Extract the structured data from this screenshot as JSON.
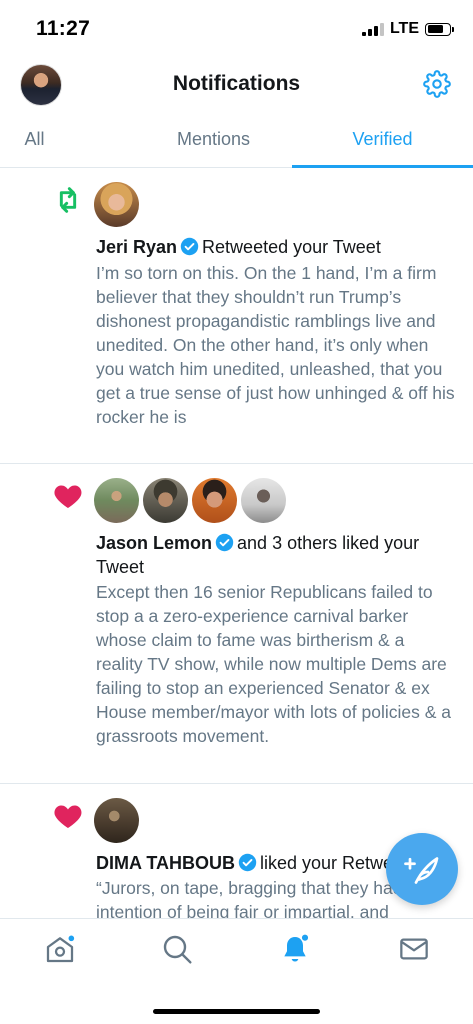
{
  "status_bar": {
    "time": "11:27",
    "network": "LTE",
    "battery_level": 0.75
  },
  "header": {
    "title": "Notifications",
    "avatar_icon": "profile-avatar",
    "settings_icon": "gear-icon"
  },
  "tabs": [
    {
      "label": "All",
      "active": false
    },
    {
      "label": "Mentions",
      "active": false
    },
    {
      "label": "Verified",
      "active": true
    }
  ],
  "notifications": [
    {
      "type": "retweet",
      "icon": "retweet-icon",
      "user": "Jeri Ryan",
      "verified": true,
      "action": "Retweeted your Tweet",
      "tweet": "I’m so torn on this. On the 1 hand, I’m a firm believer that they shouldn’t run Trump’s dishonest propagandistic ramblings live and unedited. On the other hand, it’s only when you watch him unedited, unleashed, that you get a true sense of just how unhinged & off his rocker he is"
    },
    {
      "type": "like",
      "icon": "heart-icon",
      "user": "Jason Lemon",
      "verified": true,
      "action": "and 3 others liked your Tweet",
      "tweet": "Except then 16 senior Republicans failed to stop a a zero-experience carnival barker whose claim to fame was birtherism & a reality TV show, while now multiple Dems are failing to stop an experienced Senator & ex House member/mayor with lots of policies & a grassroots movement."
    },
    {
      "type": "like",
      "icon": "heart-icon",
      "user": "DIMA TAHBOUB",
      "verified": true,
      "action": "liked your Retweet",
      "tweet": "“Jurors, on tape, bragging that they had no intention of being fair or impartial, and"
    }
  ],
  "compose": {
    "icon": "compose-tweet-icon"
  },
  "tab_bar": [
    {
      "icon": "home-icon",
      "has_dot": true
    },
    {
      "icon": "search-icon",
      "has_dot": false
    },
    {
      "icon": "bell-icon",
      "has_dot": true,
      "active": true
    },
    {
      "icon": "mail-icon",
      "has_dot": false
    }
  ],
  "colors": {
    "accent": "#1da1f2",
    "retweet": "#17bf63",
    "like": "#e0245e",
    "secondary_text": "#657786"
  }
}
